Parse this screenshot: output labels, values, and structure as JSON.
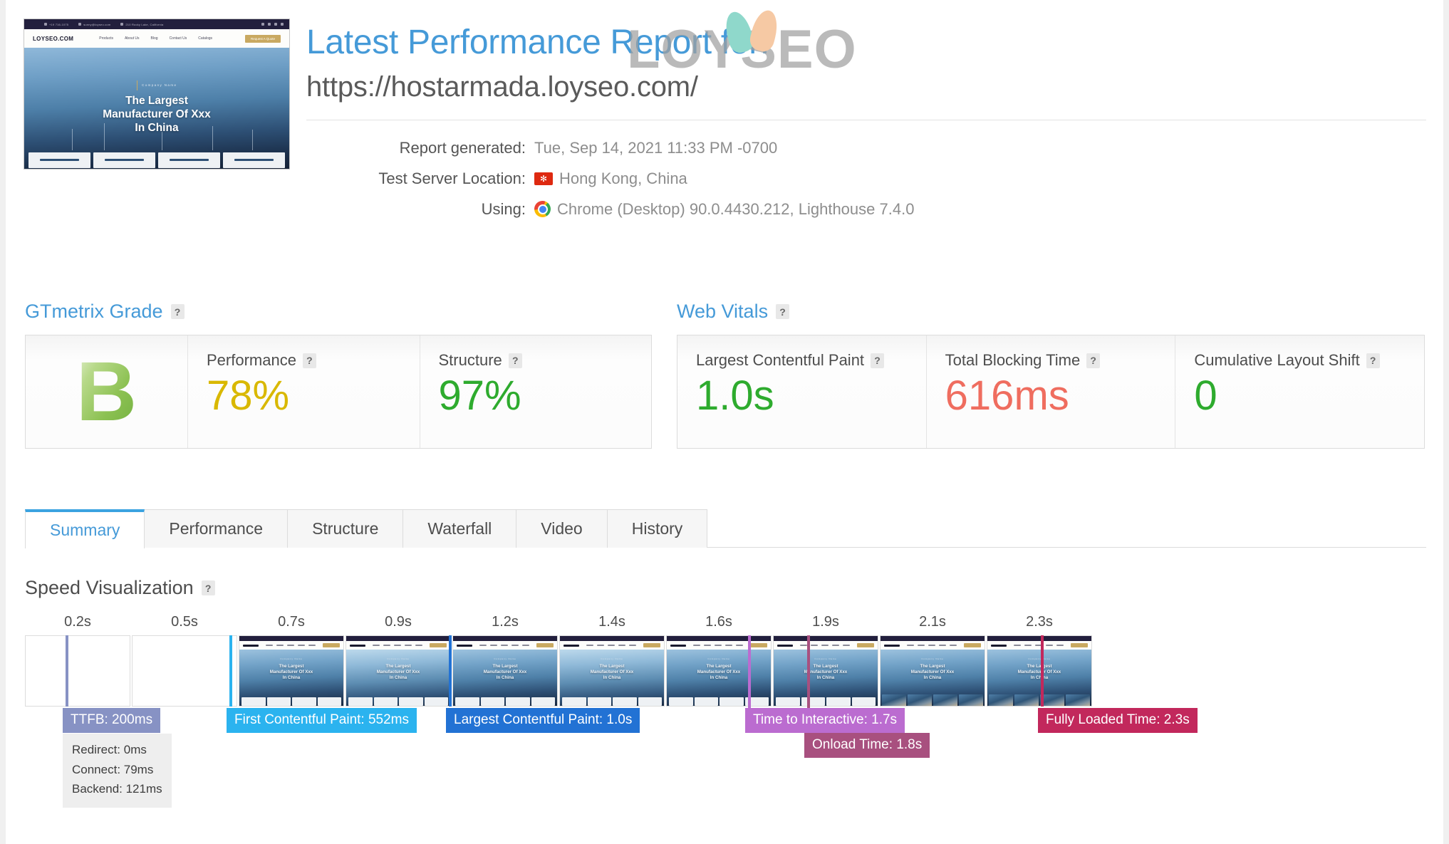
{
  "watermark": {
    "text": "LOYSEO"
  },
  "header": {
    "title": "Latest Performance Report for:",
    "url": "https://hostarmada.loyseo.com/",
    "meta": [
      {
        "label": "Report generated:",
        "value": "Tue, Sep 14, 2021 11:33 PM -0700",
        "icon": ""
      },
      {
        "label": "Test Server Location:",
        "value": "Hong Kong, China",
        "icon": "hong-kong-flag-icon"
      },
      {
        "label": "Using:",
        "value": "Chrome (Desktop) 90.0.4430.212, Lighthouse 7.4.0",
        "icon": "chrome-icon"
      }
    ]
  },
  "site_screenshot": {
    "topbar": [
      "+19 716-1075",
      "sunny@loyseo.com",
      "210 Rocky Lake, California"
    ],
    "logo": "LOYSEO.COM",
    "nav": [
      "Products",
      "About Us",
      "Blog",
      "Contact Us",
      "Catalogs"
    ],
    "cta": "Request A Quote",
    "eyebrow": "Company Name",
    "heading": "The Largest\nManufacturer Of Xxx\nIn China",
    "heading_lines": [
      "The Largest",
      "Manufacturer Of Xxx",
      "In China"
    ]
  },
  "grade_panel": {
    "title": "GTmetrix Grade",
    "help": "?",
    "grade": "B",
    "grade_color": "#8cc152",
    "metrics": [
      {
        "label": "Performance",
        "value": "78%",
        "color": "#d9b800",
        "help": "?"
      },
      {
        "label": "Structure",
        "value": "97%",
        "color": "#2eab2e",
        "help": "?"
      }
    ]
  },
  "vitals_panel": {
    "title": "Web Vitals",
    "help": "?",
    "metrics": [
      {
        "label": "Largest Contentful Paint",
        "value": "1.0s",
        "color": "#2eab2e",
        "help": "?"
      },
      {
        "label": "Total Blocking Time",
        "value": "616ms",
        "color": "#ef6d5f",
        "help": "?"
      },
      {
        "label": "Cumulative Layout Shift",
        "value": "0",
        "color": "#2eab2e",
        "help": "?"
      }
    ]
  },
  "tabs": [
    {
      "label": "Summary",
      "active": true
    },
    {
      "label": "Performance",
      "active": false
    },
    {
      "label": "Structure",
      "active": false
    },
    {
      "label": "Waterfall",
      "active": false
    },
    {
      "label": "Video",
      "active": false
    },
    {
      "label": "History",
      "active": false
    }
  ],
  "speed_visualization": {
    "title": "Speed Visualization",
    "help": "?",
    "tick_labels": [
      "0.2s",
      "0.5s",
      "0.7s",
      "0.9s",
      "1.2s",
      "1.4s",
      "1.6s",
      "1.9s",
      "2.1s",
      "2.3s"
    ],
    "frames": [
      {
        "state": "blank"
      },
      {
        "state": "blank"
      },
      {
        "state": "page",
        "bright": false,
        "photos": false
      },
      {
        "state": "page",
        "bright": true,
        "photos": false
      },
      {
        "state": "page",
        "bright": false,
        "photos": false
      },
      {
        "state": "page",
        "bright": true,
        "photos": false
      },
      {
        "state": "page",
        "bright": false,
        "photos": false
      },
      {
        "state": "page",
        "bright": false,
        "photos": false
      },
      {
        "state": "page",
        "bright": false,
        "photos": true
      },
      {
        "state": "page",
        "bright": false,
        "photos": true
      }
    ],
    "events": [
      {
        "name": "ttfb",
        "label": "TTFB: 200ms",
        "color": "#8792c4",
        "line_color": "#8792c4"
      },
      {
        "name": "first-contentful-paint",
        "label": "First Contentful Paint: 552ms",
        "color": "#2bb3ef",
        "line_color": "#2bb3ef"
      },
      {
        "name": "largest-contentful-paint",
        "label": "Largest Contentful Paint: 1.0s",
        "color": "#2272d4",
        "line_color": "#2272d4"
      },
      {
        "name": "time-to-interactive",
        "label": "Time to Interactive: 1.7s",
        "color": "#bb6cd0",
        "line_color": "#bb6cd0"
      },
      {
        "name": "onload-time",
        "label": "Onload Time: 1.8s",
        "color": "#a8507f",
        "line_color": "#a8507f"
      },
      {
        "name": "fully-loaded-time",
        "label": "Fully Loaded Time: 2.3s",
        "color": "#c2285c",
        "line_color": "#c2285c"
      }
    ],
    "ttfb_detail": [
      "Redirect: 0ms",
      "Connect: 79ms",
      "Backend: 121ms"
    ]
  }
}
